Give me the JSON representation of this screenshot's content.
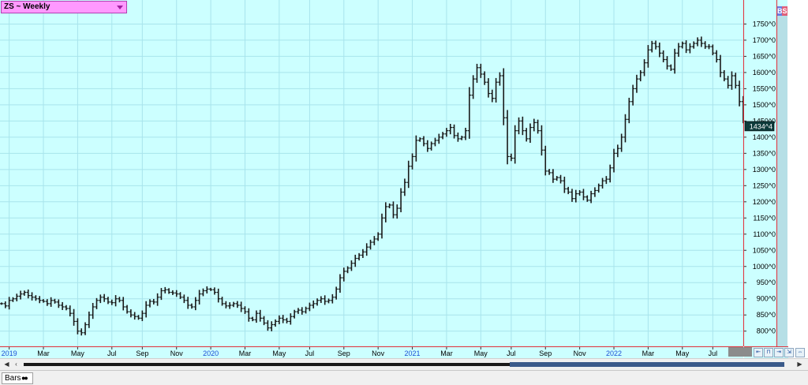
{
  "symbol": {
    "label": "ZS ~ Weekly"
  },
  "bs": {
    "b": "B",
    "s": "S"
  },
  "status": {
    "bars_label": "Bars"
  },
  "scroll": {
    "left": "◀",
    "left2": "‹",
    "right": "▶"
  },
  "colors": {
    "background": "#ccffff",
    "bars": "#1a1a1a",
    "separator": "#e0303a",
    "grid": "#a8e4ec",
    "last_price_bg": "#0d3b3b",
    "year_label": "#1a4fd6"
  },
  "chart_data": {
    "type": "bar",
    "subtype": "ohlc",
    "title": "ZS ~ Weekly",
    "xlabel": "",
    "ylabel": "",
    "ylim": [
      770,
      1795
    ],
    "last_price": "1434^4",
    "y_ticks": [
      {
        "value": 1750,
        "label": "1750^0"
      },
      {
        "value": 1700,
        "label": "1700^0"
      },
      {
        "value": 1650,
        "label": "1650^0"
      },
      {
        "value": 1600,
        "label": "1600^0"
      },
      {
        "value": 1550,
        "label": "1550^0"
      },
      {
        "value": 1500,
        "label": "1500^0"
      },
      {
        "value": 1450,
        "label": "1450^0"
      },
      {
        "value": 1400,
        "label": "1400^0"
      },
      {
        "value": 1350,
        "label": "1350^0"
      },
      {
        "value": 1300,
        "label": "1300^0"
      },
      {
        "value": 1250,
        "label": "1250^0"
      },
      {
        "value": 1200,
        "label": "1200^0"
      },
      {
        "value": 1150,
        "label": "1150^0"
      },
      {
        "value": 1100,
        "label": "1100^0"
      },
      {
        "value": 1050,
        "label": "1050^0"
      },
      {
        "value": 1000,
        "label": "1000^0"
      },
      {
        "value": 950,
        "label": "950^0"
      },
      {
        "value": 900,
        "label": "900^0"
      },
      {
        "value": 850,
        "label": "850^0"
      },
      {
        "value": 800,
        "label": "800^0"
      }
    ],
    "x_labels": [
      {
        "label": "2019",
        "year": true,
        "week": 2
      },
      {
        "label": "Mar",
        "year": false,
        "week": 11
      },
      {
        "label": "May",
        "year": false,
        "week": 20
      },
      {
        "label": "Jul",
        "year": false,
        "week": 29
      },
      {
        "label": "Sep",
        "year": false,
        "week": 37
      },
      {
        "label": "Nov",
        "year": false,
        "week": 46
      },
      {
        "label": "2020",
        "year": true,
        "week": 55
      },
      {
        "label": "Mar",
        "year": false,
        "week": 64
      },
      {
        "label": "May",
        "year": false,
        "week": 73
      },
      {
        "label": "Jul",
        "year": false,
        "week": 81
      },
      {
        "label": "Sep",
        "year": false,
        "week": 90
      },
      {
        "label": "Nov",
        "year": false,
        "week": 99
      },
      {
        "label": "2021",
        "year": true,
        "week": 108
      },
      {
        "label": "Mar",
        "year": false,
        "week": 117
      },
      {
        "label": "May",
        "year": false,
        "week": 126
      },
      {
        "label": "Jul",
        "year": false,
        "week": 134
      },
      {
        "label": "Sep",
        "year": false,
        "week": 143
      },
      {
        "label": "Nov",
        "year": false,
        "week": 152
      },
      {
        "label": "2022",
        "year": true,
        "week": 161
      },
      {
        "label": "Mar",
        "year": false,
        "week": 170
      },
      {
        "label": "May",
        "year": false,
        "week": 179
      },
      {
        "label": "Jul",
        "year": false,
        "week": 187
      }
    ],
    "close": [
      885,
      878,
      895,
      900,
      908,
      915,
      920,
      910,
      905,
      900,
      895,
      892,
      885,
      895,
      890,
      880,
      875,
      870,
      855,
      830,
      800,
      795,
      820,
      850,
      875,
      895,
      905,
      900,
      890,
      888,
      900,
      895,
      875,
      860,
      850,
      845,
      840,
      855,
      880,
      892,
      890,
      905,
      925,
      928,
      920,
      918,
      915,
      905,
      895,
      880,
      875,
      895,
      915,
      925,
      930,
      928,
      920,
      900,
      885,
      878,
      880,
      885,
      880,
      870,
      860,
      840,
      835,
      855,
      840,
      825,
      810,
      820,
      830,
      840,
      835,
      830,
      845,
      860,
      865,
      860,
      870,
      880,
      885,
      895,
      900,
      892,
      895,
      905,
      930,
      965,
      985,
      995,
      1010,
      1025,
      1035,
      1045,
      1060,
      1075,
      1085,
      1100,
      1150,
      1185,
      1190,
      1160,
      1180,
      1230,
      1260,
      1310,
      1340,
      1390,
      1395,
      1380,
      1365,
      1380,
      1390,
      1400,
      1410,
      1420,
      1430,
      1405,
      1395,
      1400,
      1420,
      1530,
      1580,
      1615,
      1595,
      1570,
      1535,
      1520,
      1570,
      1590,
      1460,
      1340,
      1335,
      1420,
      1450,
      1420,
      1395,
      1430,
      1445,
      1420,
      1360,
      1295,
      1290,
      1270,
      1275,
      1265,
      1240,
      1230,
      1210,
      1225,
      1230,
      1215,
      1205,
      1225,
      1235,
      1250,
      1265,
      1270,
      1305,
      1350,
      1365,
      1400,
      1455,
      1510,
      1550,
      1580,
      1600,
      1630,
      1670,
      1690,
      1680,
      1660,
      1640,
      1620,
      1610,
      1660,
      1680,
      1690,
      1670,
      1680,
      1690,
      1700,
      1690,
      1680,
      1680,
      1660,
      1640,
      1600,
      1580,
      1560,
      1590,
      1560,
      1510,
      1460,
      1434
    ],
    "x_extent": 193
  }
}
